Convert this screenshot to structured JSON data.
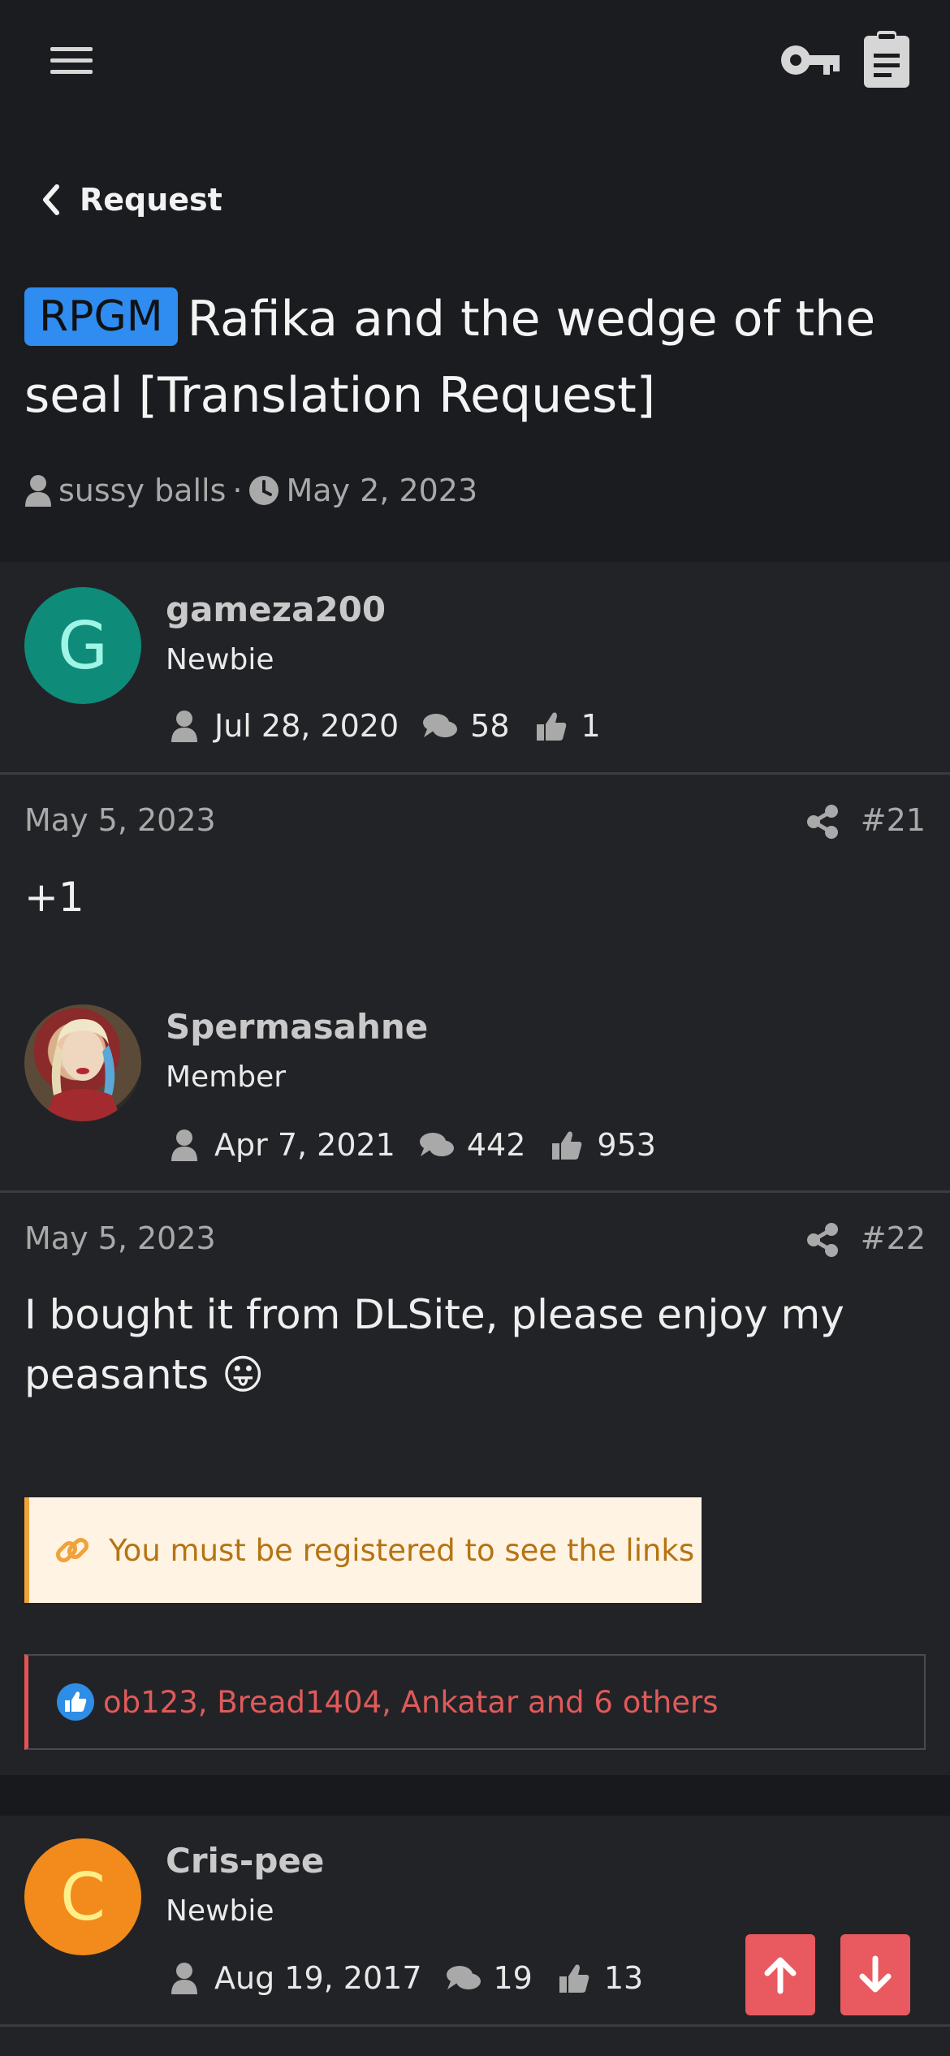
{
  "header": {
    "breadcrumb": "Request",
    "prefix": "RPGM",
    "title": "Rafika and the wedge of the seal [Translation Request]",
    "author": "sussy balls",
    "separator": "·",
    "date": "May 2, 2023"
  },
  "posts": [
    {
      "avatar_letter": "G",
      "avatar_color": "#0e8b79",
      "username": "gameza200",
      "user_title": "Newbie",
      "joined": "Jul 28, 2020",
      "messages": "58",
      "reactions": "1",
      "date": "May 5, 2023",
      "number": "#21",
      "body": "+1"
    },
    {
      "avatar_letter": "",
      "username": "Spermasahne",
      "user_title": "Member",
      "joined": "Apr 7, 2021",
      "messages": "442",
      "reactions": "953",
      "date": "May 5, 2023",
      "number": "#22",
      "body": "I bought it from DLSite, please enjoy my peasants",
      "emoji": "😛",
      "notice": "You must be registered to see the links",
      "reacted_by": "ob123, Bread1404, Ankatar and 6 others"
    },
    {
      "avatar_letter": "C",
      "avatar_color": "#f28b1c",
      "username": "Cris-pee",
      "user_title": "Newbie",
      "joined": "Aug 19, 2017",
      "messages": "19",
      "reactions": "13"
    }
  ],
  "icons": {
    "menu": "hamburger-menu-icon",
    "key": "key-icon",
    "clipboard": "clipboard-icon",
    "back": "chevron-left-icon",
    "user": "user-icon",
    "clock": "clock-icon",
    "comments": "comments-icon",
    "thumbs": "thumbs-up-icon",
    "share": "share-icon",
    "link": "link-icon",
    "scroll_up": "arrow-up-icon",
    "scroll_down": "arrow-down-icon"
  },
  "colors": {
    "prefix_bg": "#2f8cf0",
    "accent_red": "#e85a5f",
    "notice_bg": "#fff3e3",
    "notice_text": "#b57413"
  }
}
